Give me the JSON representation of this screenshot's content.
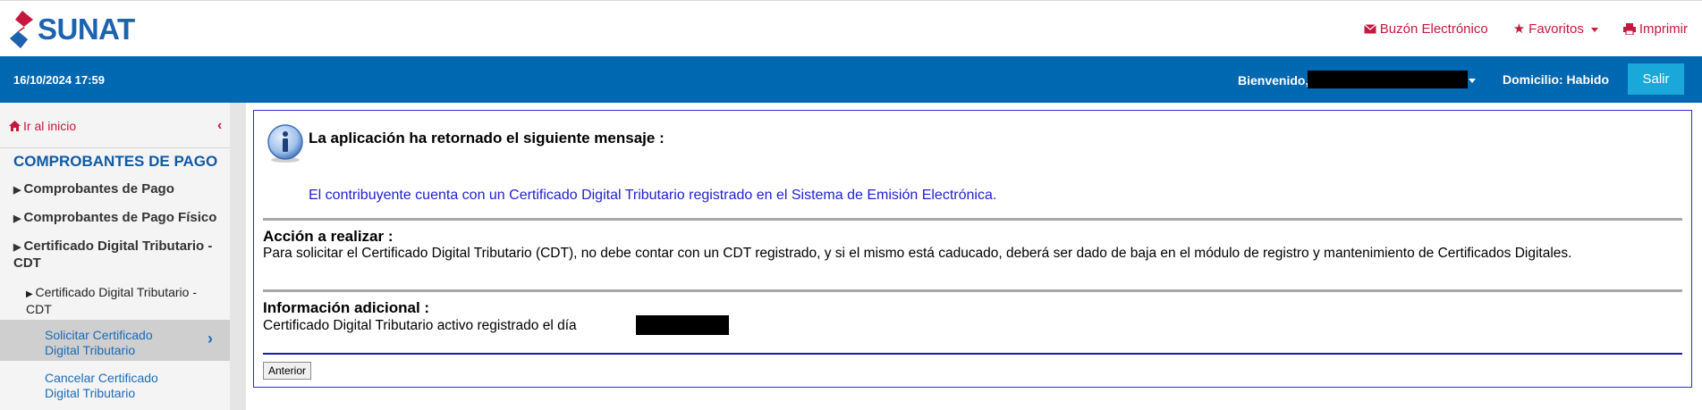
{
  "header": {
    "brand": "SUNAT",
    "links": [
      {
        "label": "Buzón Electrónico",
        "icon": "envelope-icon"
      },
      {
        "label": "Favoritos",
        "icon": "star-icon"
      },
      {
        "label": "Imprimir",
        "icon": "printer-icon"
      }
    ]
  },
  "bar": {
    "datetime": "16/10/2024 17:59",
    "welcome": "Bienvenido,",
    "domicilio": "Domicilio: Habido",
    "logout": "Salir"
  },
  "sidebar": {
    "home": "Ir al inicio",
    "section": "COMPROBANTES DE PAGO",
    "items": [
      {
        "label": "Comprobantes de Pago"
      },
      {
        "label": "Comprobantes de Pago Físico"
      },
      {
        "label": "Certificado Digital Tributario - CDT"
      }
    ],
    "subitem": "Certificado Digital Tributario - CDT",
    "leaves": [
      {
        "label": "Solicitar Certificado Digital Tributario",
        "active": true
      },
      {
        "label": "Cancelar Certificado Digital Tributario",
        "active": false
      }
    ]
  },
  "main": {
    "title": "La aplicación ha retornado el siguiente mensaje :",
    "message": "El contribuyente cuenta con un Certificado Digital Tributario registrado en el Sistema de Emisión Electrónica.",
    "action_label": "Acción a realizar :",
    "action_text": "Para solicitar el Certificado Digital Tributario (CDT), no debe contar con un CDT registrado, y si el mismo está caducado, deberá ser dado de baja en el módulo de registro y mantenimiento de Certificados Digitales.",
    "info_label": "Información adicional :",
    "info_text": "Certificado Digital Tributario activo registrado el día",
    "button": "Anterior"
  },
  "colors": {
    "brand_blue": "#0067b1",
    "accent_red": "#c5183f",
    "logout_cyan": "#19a8d9",
    "message_blue": "#1f1fd0"
  }
}
